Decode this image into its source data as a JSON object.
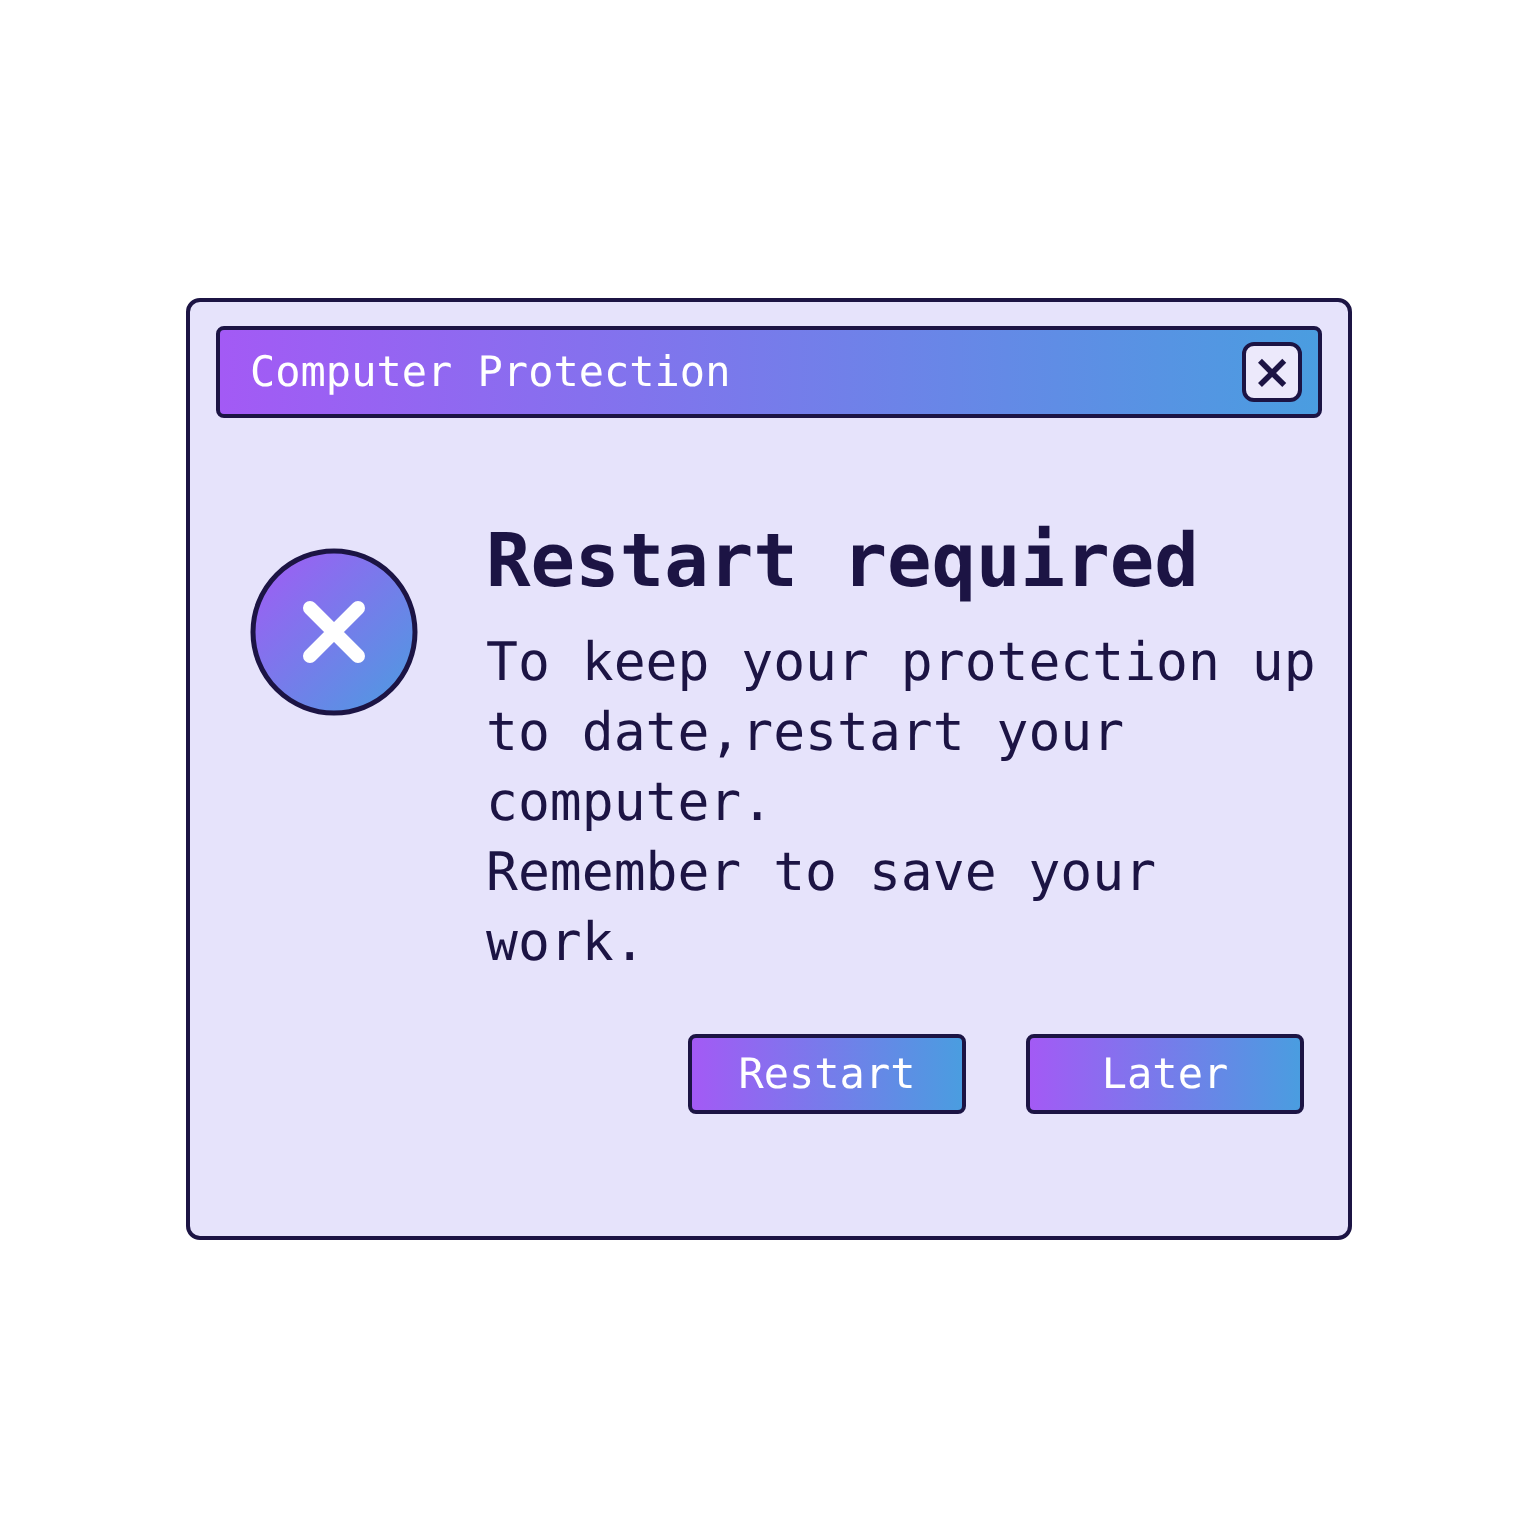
{
  "window": {
    "title": "Computer Protection",
    "close_icon": "×"
  },
  "message": {
    "heading": "Restart required",
    "paragraphs": [
      "To keep your protection up to date,restart your computer.",
      "Remember to save your work."
    ]
  },
  "buttons": [
    {
      "label": "Restart"
    },
    {
      "label": "Later"
    }
  ]
}
